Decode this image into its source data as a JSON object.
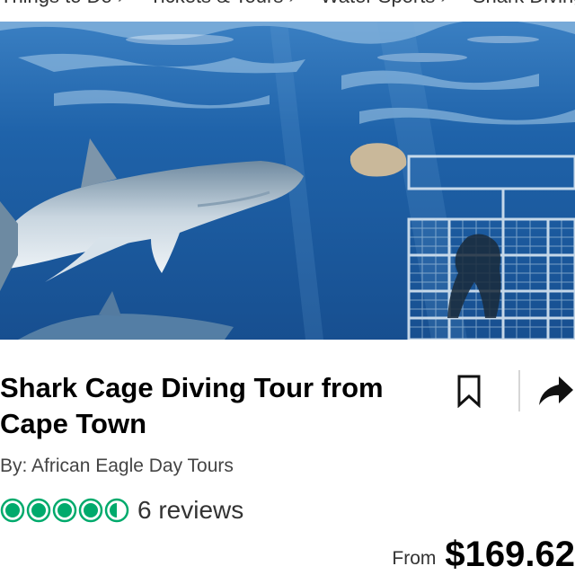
{
  "breadcrumb": {
    "items": [
      "Things to Do",
      "Tickets & Tours",
      "Water Sports",
      "Shark Diving"
    ]
  },
  "hero": {
    "icon": "shark-cage-diving-photo",
    "colors": {
      "water_top": "#2f6fb0",
      "water_mid": "#1f5ea6",
      "water_deep": "#154a8a"
    }
  },
  "product": {
    "title": "Shark Cage Diving Tour from Cape Town",
    "byline": "By: African Eagle Day Tours",
    "rating": {
      "value": 4.5,
      "max": 5,
      "color": "#00aa6c"
    },
    "reviews_label": "6 reviews",
    "price_prefix": "From",
    "price": "$169.62"
  },
  "actions": {
    "bookmark_icon": "bookmark-icon",
    "share_icon": "share-arrow-icon"
  }
}
